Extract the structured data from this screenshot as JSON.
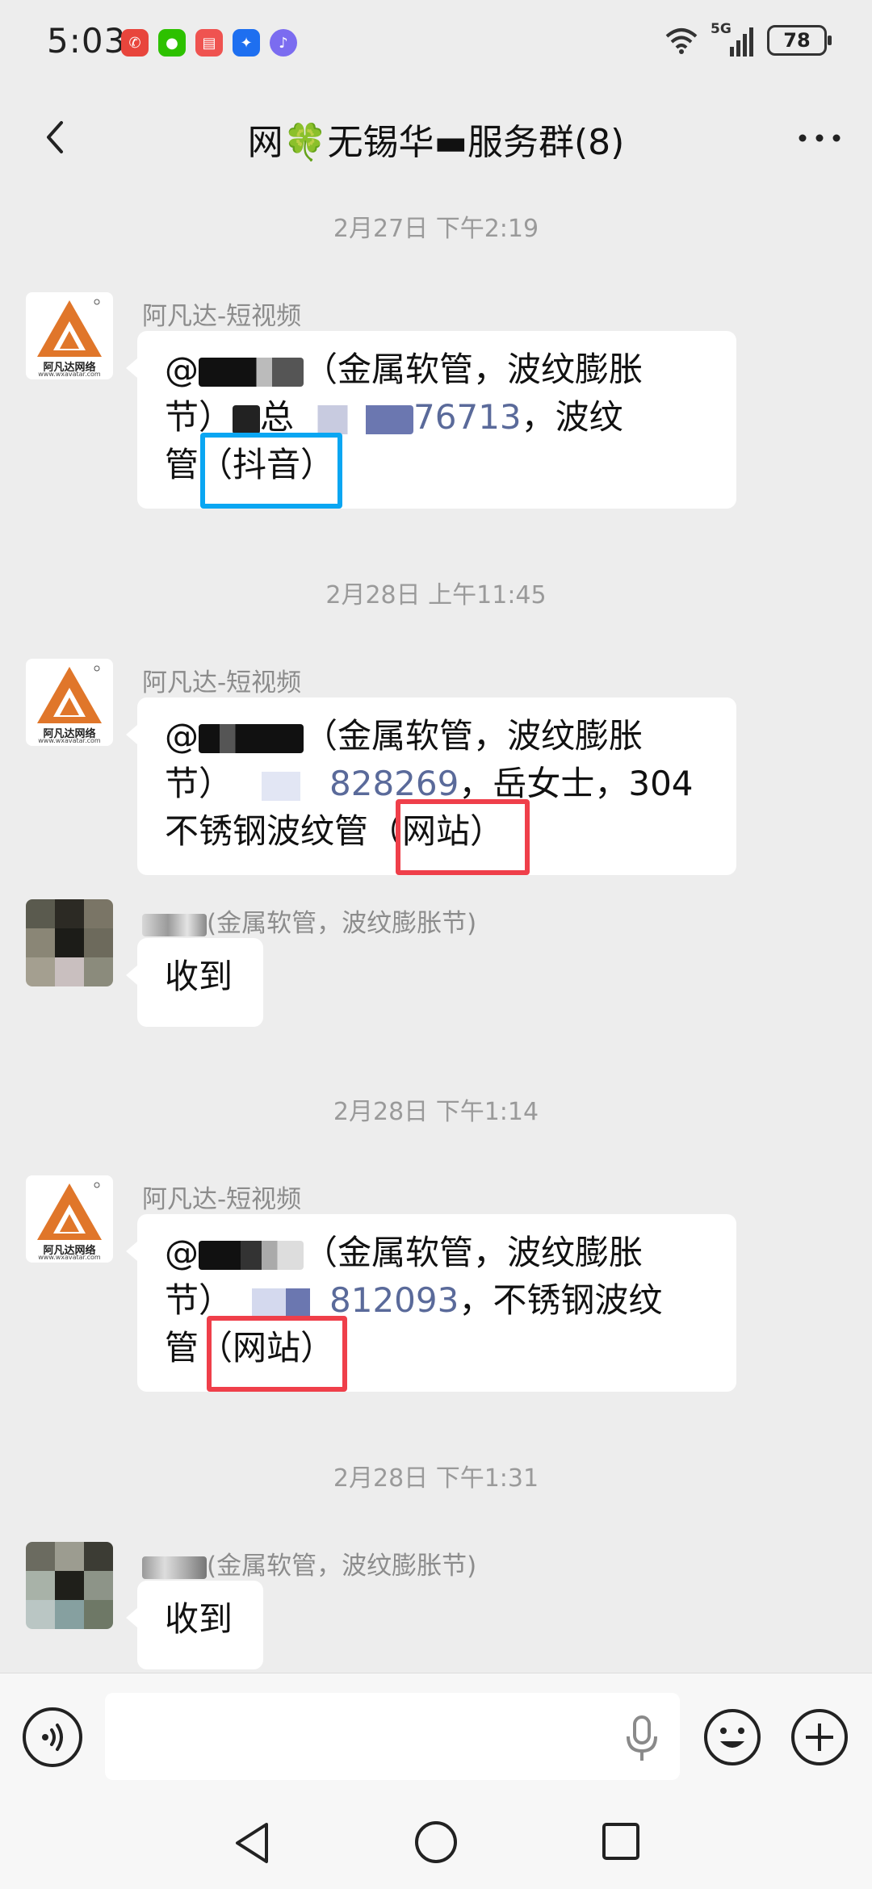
{
  "status": {
    "time": "5:03",
    "network": "5G",
    "battery": "78",
    "notification_icons": [
      "missed-call-icon",
      "wechat-icon",
      "reader-icon",
      "tips-icon",
      "music-icon"
    ]
  },
  "header": {
    "title": "网🍀无锡华▬服务群(8)"
  },
  "messages": [
    {
      "timestamp": "2月27日 下午2:19",
      "sender": "阿凡达-短视频",
      "lines": [
        "@▇▇ (金属软管，波纹膨胀",
        "节) ▇总 ▇▇▇76713，波纹",
        "管 (抖音)"
      ],
      "phone_suffix": "76713",
      "tag": "(抖音)"
    },
    {
      "timestamp": "2月28日 上午11:45",
      "sender": "阿凡达-短视频",
      "lines": [
        "@▇▇ (金属软管，波纹膨胀",
        "节) ▇▇828269，岳女士，304",
        "不锈钢波纹管 (网站)"
      ],
      "phone_suffix": "828269",
      "contact": "岳女士",
      "tag": "(网站)"
    },
    {
      "sender": "(金属软管，波纹膨胀节)",
      "text": "收到"
    },
    {
      "timestamp": "2月28日 下午1:14",
      "sender": "阿凡达-短视频",
      "lines": [
        "@▇▇ (金属软管，波纹膨胀",
        "节) ▇▇812093，不锈钢波纹",
        "管 (网站)"
      ],
      "phone_suffix": "812093",
      "tag": "(网站)"
    },
    {
      "timestamp": "2月28日 下午1:31",
      "sender": "(金属软管，波纹膨胀节)",
      "text": "收到"
    }
  ],
  "bubble_text": {
    "m1_l1a": "@",
    "m1_l1b": "（金属软管，波纹膨胀",
    "m1_l2a": "节）",
    "m1_l2b": "总",
    "m1_l2num": "76713",
    "m1_l2c": "，波纹",
    "m1_l3a": "管",
    "m1_tag": "（抖音）",
    "m2_l1a": "@",
    "m2_l1b": "（金属软管，波纹膨胀",
    "m2_l2a": "节）",
    "m2_l2num": "828269",
    "m2_l2c": "，岳女士，304",
    "m2_l3a": "不锈钢波纹管",
    "m2_tag": "（网站）",
    "m4_l1a": "@",
    "m4_l1b": "（金属软管，波纹膨胀",
    "m4_l2a": "节）",
    "m4_l2num": "812093",
    "m4_l2c": "，不锈钢波纹",
    "m4_l3a": "管",
    "m4_tag": "（网站）"
  },
  "logo": {
    "name": "阿凡达网络",
    "url": "www.wxavatar.com"
  },
  "colors": {
    "brand_orange": "#e0762a",
    "link_blue": "#5a6a9a",
    "highlight_blue": "#0aa6f2",
    "highlight_red": "#ef3f4a",
    "background": "#ededed"
  },
  "input": {
    "placeholder": ""
  }
}
